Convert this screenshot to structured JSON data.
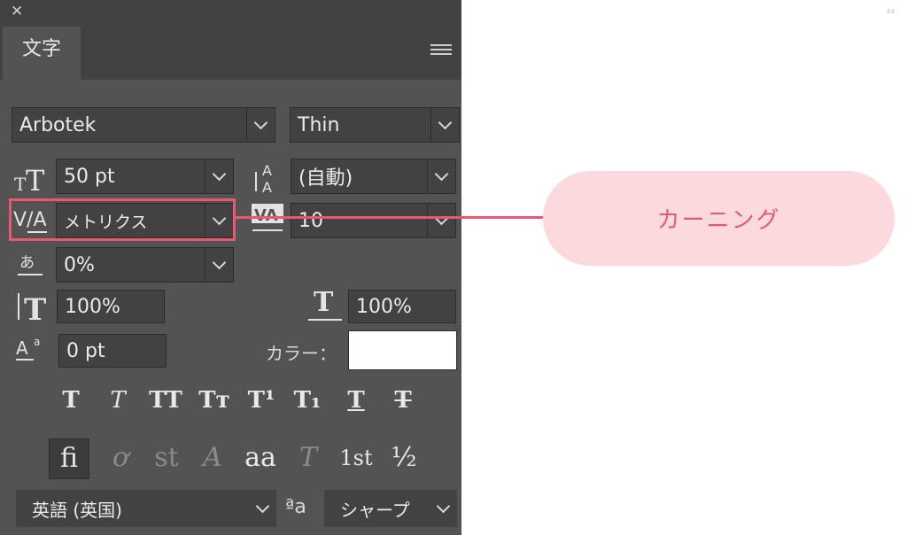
{
  "panel": {
    "tab_label": "文字",
    "font_family": "Arbotek",
    "font_style": "Thin",
    "font_size": "50 pt",
    "leading": "(自動)",
    "kerning": "メトリクス",
    "tracking": "10",
    "tsume": "0%",
    "vertical_scale": "100%",
    "horizontal_scale": "100%",
    "baseline_shift": "0 pt",
    "color_label": "カラー：",
    "color_value": "#ffffff",
    "language": "英語 (英国)",
    "antialias": "シャープ",
    "antialias_glyph": "ªa",
    "style_buttons": [
      "T",
      "T",
      "TT",
      "Tт",
      "T¹",
      "T₁",
      "T",
      "T"
    ],
    "opentype_buttons": [
      "ﬁ",
      "ơ",
      "st",
      "A",
      "aa",
      "T",
      "1st",
      "½"
    ]
  },
  "annotation": {
    "callout_label": "カーニング",
    "accent": "#e7596e",
    "callout_bg": "#fbd9dd"
  }
}
